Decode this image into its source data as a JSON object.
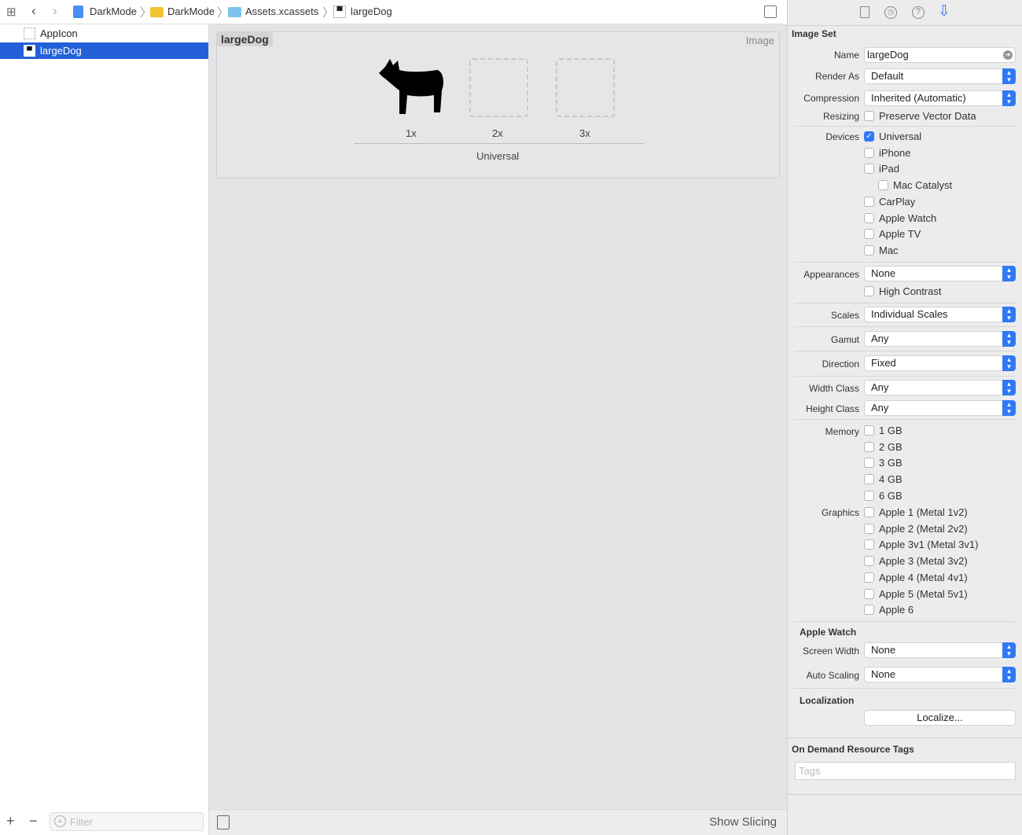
{
  "breadcrumb": [
    "DarkMode",
    "DarkMode",
    "Assets.xcassets",
    "largeDog"
  ],
  "navigator": {
    "items": [
      {
        "label": "AppIcon"
      },
      {
        "label": "largeDog",
        "selected": true
      }
    ],
    "filter_placeholder": "Filter"
  },
  "editor": {
    "set_name": "largeDog",
    "type_label": "Image",
    "slots": [
      "1x",
      "2x",
      "3x"
    ],
    "group_label": "Universal",
    "show_slicing": "Show Slicing"
  },
  "inspector": {
    "section": "Image Set",
    "name_label": "Name",
    "name_value": "largeDog",
    "render_label": "Render As",
    "render_value": "Default",
    "compression_label": "Compression",
    "compression_value": "Inherited (Automatic)",
    "resizing_label": "Resizing",
    "resizing_option": "Preserve Vector Data",
    "devices_label": "Devices",
    "devices": [
      "Universal",
      "iPhone",
      "iPad",
      "Mac Catalyst",
      "CarPlay",
      "Apple Watch",
      "Apple TV",
      "Mac"
    ],
    "appearances_label": "Appearances",
    "appearances_value": "None",
    "high_contrast": "High Contrast",
    "scales_label": "Scales",
    "scales_value": "Individual Scales",
    "gamut_label": "Gamut",
    "gamut_value": "Any",
    "direction_label": "Direction",
    "direction_value": "Fixed",
    "width_label": "Width Class",
    "width_value": "Any",
    "height_label": "Height Class",
    "height_value": "Any",
    "memory_label": "Memory",
    "memory": [
      "1 GB",
      "2 GB",
      "3 GB",
      "4 GB",
      "6 GB"
    ],
    "graphics_label": "Graphics",
    "graphics": [
      "Apple 1 (Metal 1v2)",
      "Apple 2 (Metal 2v2)",
      "Apple 3v1 (Metal 3v1)",
      "Apple 3 (Metal 3v2)",
      "Apple 4 (Metal 4v1)",
      "Apple 5 (Metal 5v1)",
      "Apple 6"
    ],
    "watch_header": "Apple Watch",
    "screen_width_label": "Screen Width",
    "screen_width_value": "None",
    "auto_scaling_label": "Auto Scaling",
    "auto_scaling_value": "None",
    "localization_header": "Localization",
    "localize_button": "Localize...",
    "odr_header": "On Demand Resource Tags",
    "tags_placeholder": "Tags"
  },
  "colors": {
    "accent": "#2f7af4",
    "selection": "#2360d8"
  }
}
